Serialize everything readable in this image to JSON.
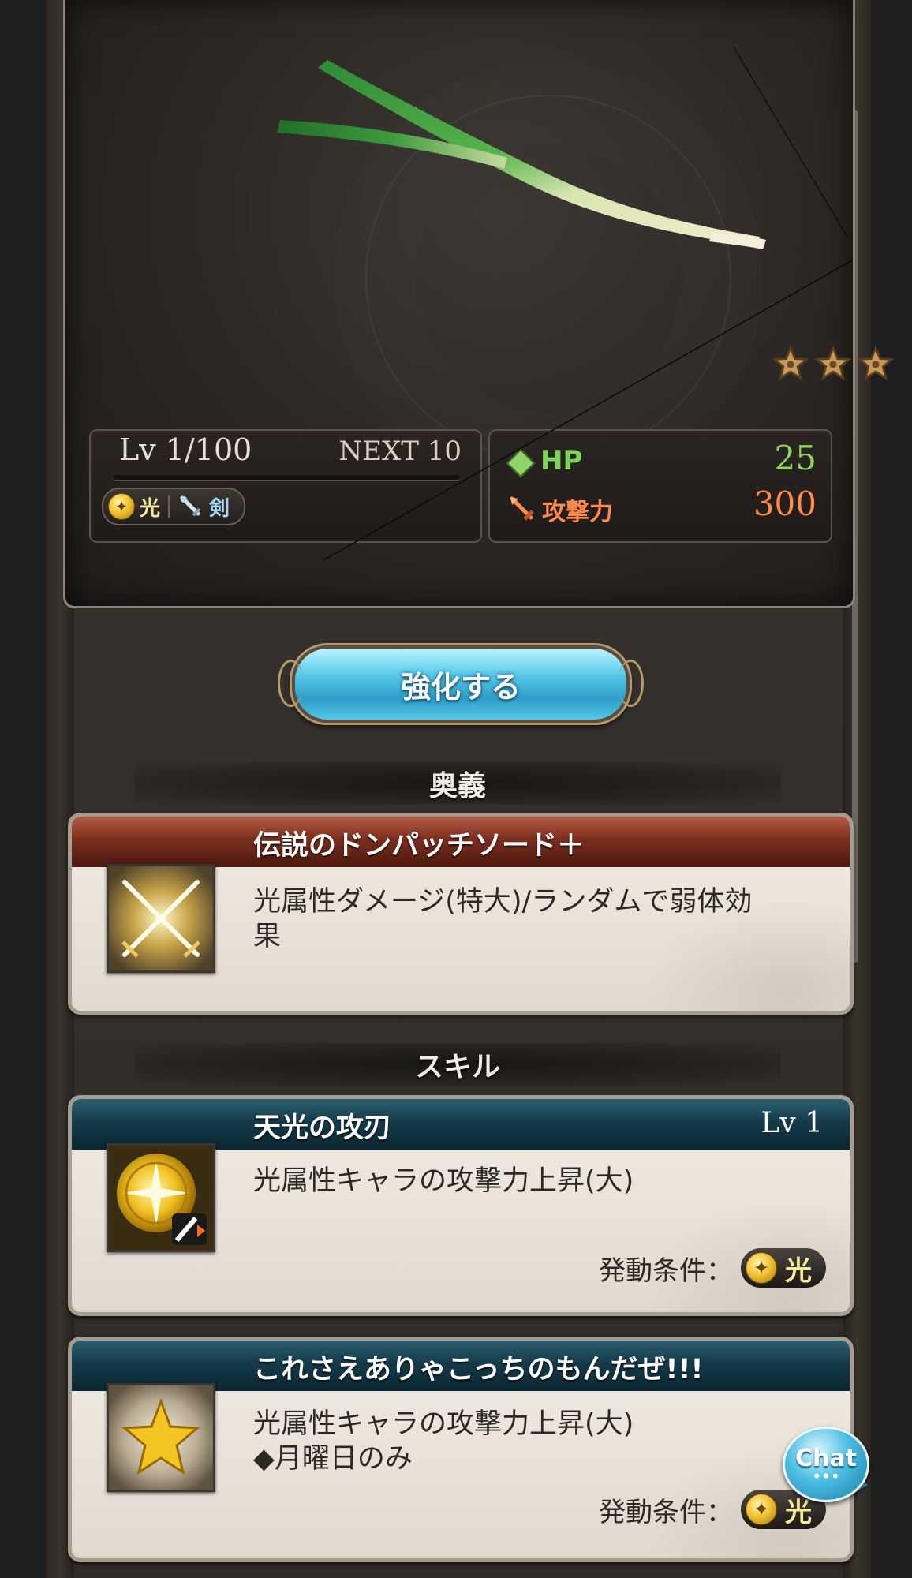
{
  "weapon": {
    "image_icon": "green-onion-icon",
    "rarity_stars": 3
  },
  "level": {
    "label": "Lv 1/100",
    "next_label": "NEXT",
    "next_value": "10",
    "exp_fraction": 0
  },
  "type_badge": {
    "element": "光",
    "element_icon": "light-element-icon",
    "weapon_type": "剣",
    "weapon_type_icon": "sword-icon"
  },
  "stats": {
    "hp_label": "HP",
    "hp_value": "25",
    "atk_label": "攻撃力",
    "atk_value": "300"
  },
  "enhance_button": {
    "label": "強化する"
  },
  "ougi_section": {
    "title": "奥義",
    "name": "伝説のドンパッチソード＋",
    "description_line1": "光属性ダメージ(特大)/ランダムで弱体効",
    "description_line2": "果",
    "icon": "crossed-swords-icon"
  },
  "skill_section": {
    "title": "スキル",
    "skills": [
      {
        "name": "天光の攻刃",
        "level": "Lv 1",
        "description_line1": "光属性キャラの攻撃力上昇(大)",
        "description_line2": "",
        "condition_label": "発動条件：",
        "condition_value": "光",
        "icon": "light-attack-up-icon"
      },
      {
        "name": "これさえありゃこっちのもんだぜ!!!",
        "level": "",
        "description_line1": "光属性キャラの攻撃力上昇(大)",
        "description_line2": "◆月曜日のみ",
        "condition_label": "発動条件：",
        "condition_value": "光",
        "icon": "gold-star-icon"
      }
    ]
  },
  "chat": {
    "label": "Chat",
    "dots": "•••"
  },
  "colors": {
    "hp": "#7ed45a",
    "atk": "#ff8a4a",
    "ougi_header": "#7a2e1e",
    "skill_header": "#143b4a",
    "button_blue": "#5ccdec"
  }
}
